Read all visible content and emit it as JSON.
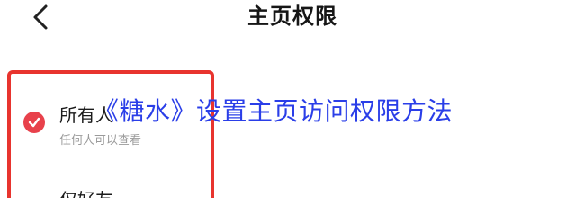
{
  "nav": {
    "title": "主页权限"
  },
  "options": {
    "all": {
      "title": "所有人",
      "description": "任何人可以查看",
      "selected": true
    },
    "friends": {
      "title": "仅好友"
    }
  },
  "overlay": {
    "caption": "《糖水》设置主页访问权限方法"
  },
  "colors": {
    "accent": "#e8414b",
    "highlight_border": "#e8342e",
    "overlay_text": "#2a3ee8"
  }
}
